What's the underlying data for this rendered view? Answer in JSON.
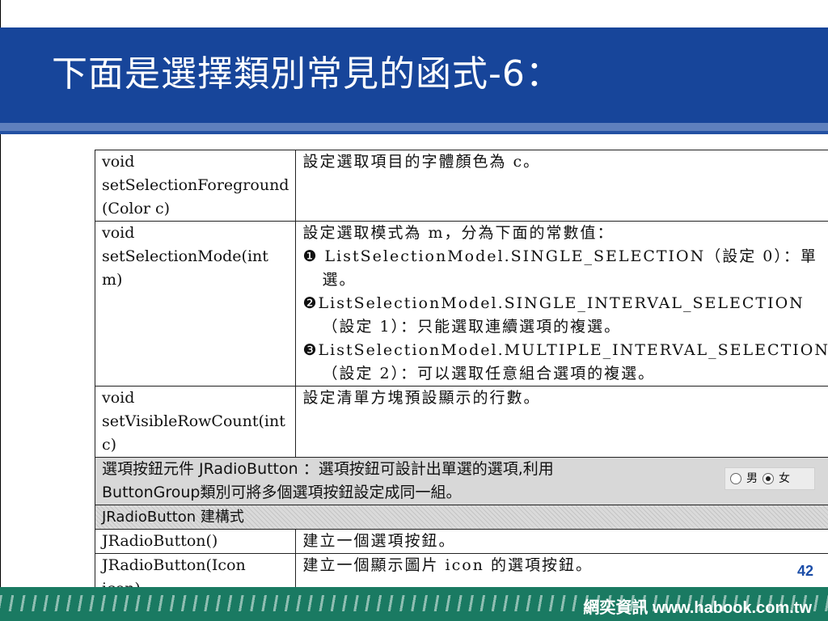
{
  "slide": {
    "title": "下面是選擇類別常見的函式-6：",
    "page_number": "42",
    "footer_brand": "網奕資訊 www.habook.com.tw"
  },
  "table": {
    "rows": [
      {
        "method": "void setSelectionForeground (Color c)",
        "desc": "設定選取項目的字體顏色為 c。"
      },
      {
        "method": "void setSelectionMode(int m)",
        "desc_intro": "設定選取模式為 m，分為下面的常數值：",
        "items": [
          "❶ ListSelectionModel.SINGLE_SELECTION（設定 0）：單選。",
          "❷ListSelectionModel.SINGLE_INTERVAL_SELECTION（設定 1）：只能選取連續選項的複選。",
          "❸ListSelectionModel.MULTIPLE_INTERVAL_SELECTION（設定 2）：可以選取任意組合選項的複選。"
        ]
      },
      {
        "method": "void setVisibleRowCount(int c)",
        "desc": "設定清單方塊預設顯示的行數。"
      }
    ],
    "radio_section": {
      "text": "選項按鈕元件 JRadioButton ：選項按鈕可設計出單選的選項,利用 ButtonGroup類別可將多個選項按鈕設定成同一組。",
      "demo_options": [
        "男",
        "女"
      ],
      "demo_selected": "女"
    },
    "constructor_header": "JRadioButton 建構式",
    "constructors": [
      {
        "signature": "JRadioButton()",
        "desc": "建立一個選項按鈕。"
      },
      {
        "signature": "JRadioButton(Icon icon)",
        "desc": "建立一個顯示圖片 icon 的選項按鈕。"
      }
    ]
  }
}
